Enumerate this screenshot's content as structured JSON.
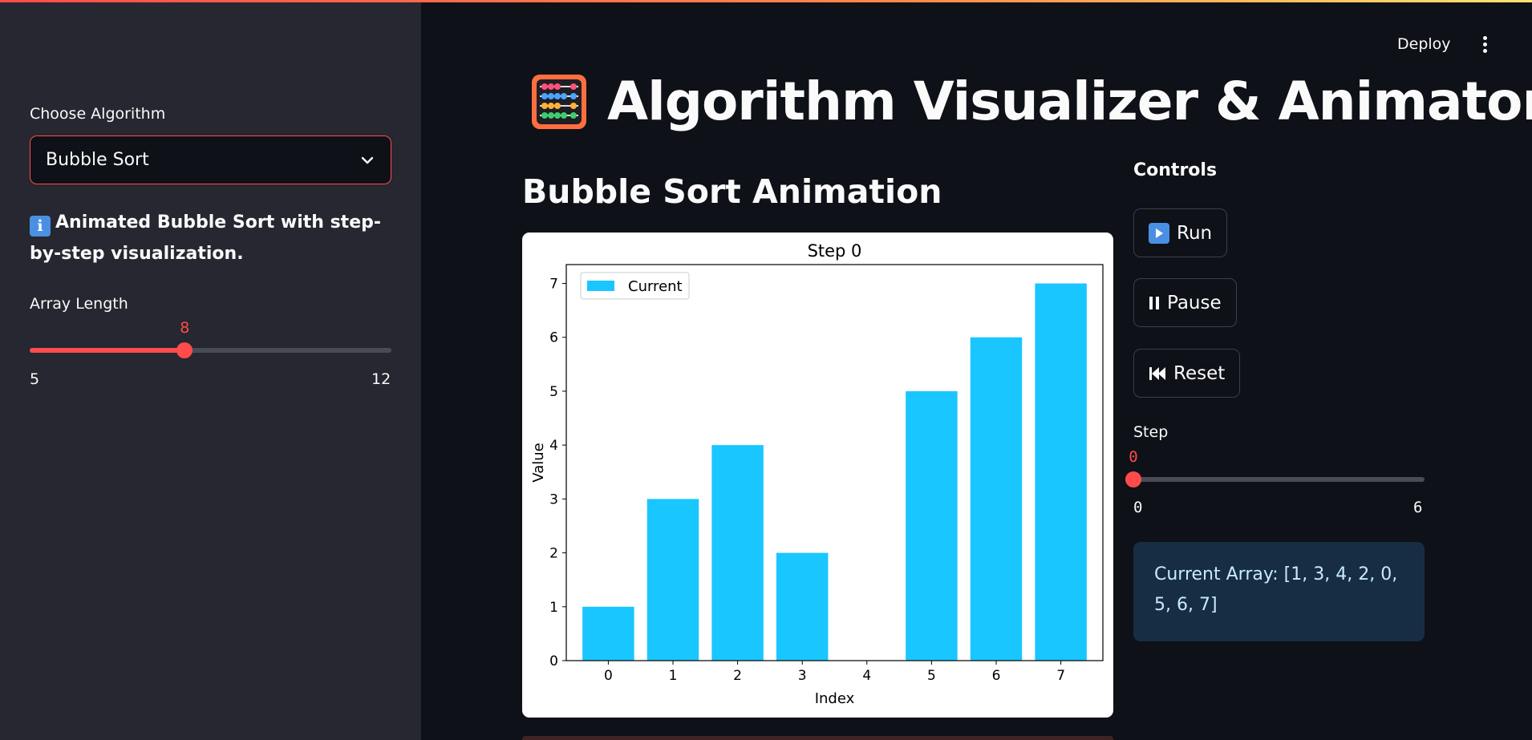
{
  "header": {
    "deploy_label": "Deploy"
  },
  "sidebar": {
    "algorithm_label": "Choose Algorithm",
    "algorithm_selected": "Bubble Sort",
    "info_text": "Animated Bubble Sort with step-by-step visualization.",
    "info_icon": "info-icon",
    "array_length": {
      "label": "Array Length",
      "value": "8",
      "min": "5",
      "max": "12",
      "fraction": 0.4286
    }
  },
  "main": {
    "title": "Algorithm Visualizer & Animator",
    "title_icon": "abacus-icon",
    "subtitle": "Bubble Sort Animation",
    "controls": {
      "heading": "Controls",
      "run_label": "Run",
      "pause_label": "Pause",
      "reset_label": "Reset"
    },
    "step": {
      "label": "Step",
      "value": "0",
      "min": "0",
      "max": "6",
      "fraction": 0
    },
    "current_array": "Current Array: [1, 3, 4, 2, 0, 5, 6, 7]"
  },
  "colors": {
    "accent": "#ff4b4b",
    "bar": "#1ac6ff",
    "sidebar_bg": "#262730",
    "main_bg": "#0e1117",
    "info_box_bg": "#172d43"
  },
  "chart_data": {
    "type": "bar",
    "title": "Step 0",
    "xlabel": "Index",
    "ylabel": "Value",
    "categories": [
      "0",
      "1",
      "2",
      "3",
      "4",
      "5",
      "6",
      "7"
    ],
    "series": [
      {
        "name": "Current",
        "values": [
          1,
          3,
          4,
          2,
          0,
          5,
          6,
          7
        ]
      }
    ],
    "yticks": [
      "0",
      "1",
      "2",
      "3",
      "4",
      "5",
      "6",
      "7"
    ],
    "ylim": [
      0,
      7.35
    ],
    "legend": "top-left",
    "grid": false
  }
}
